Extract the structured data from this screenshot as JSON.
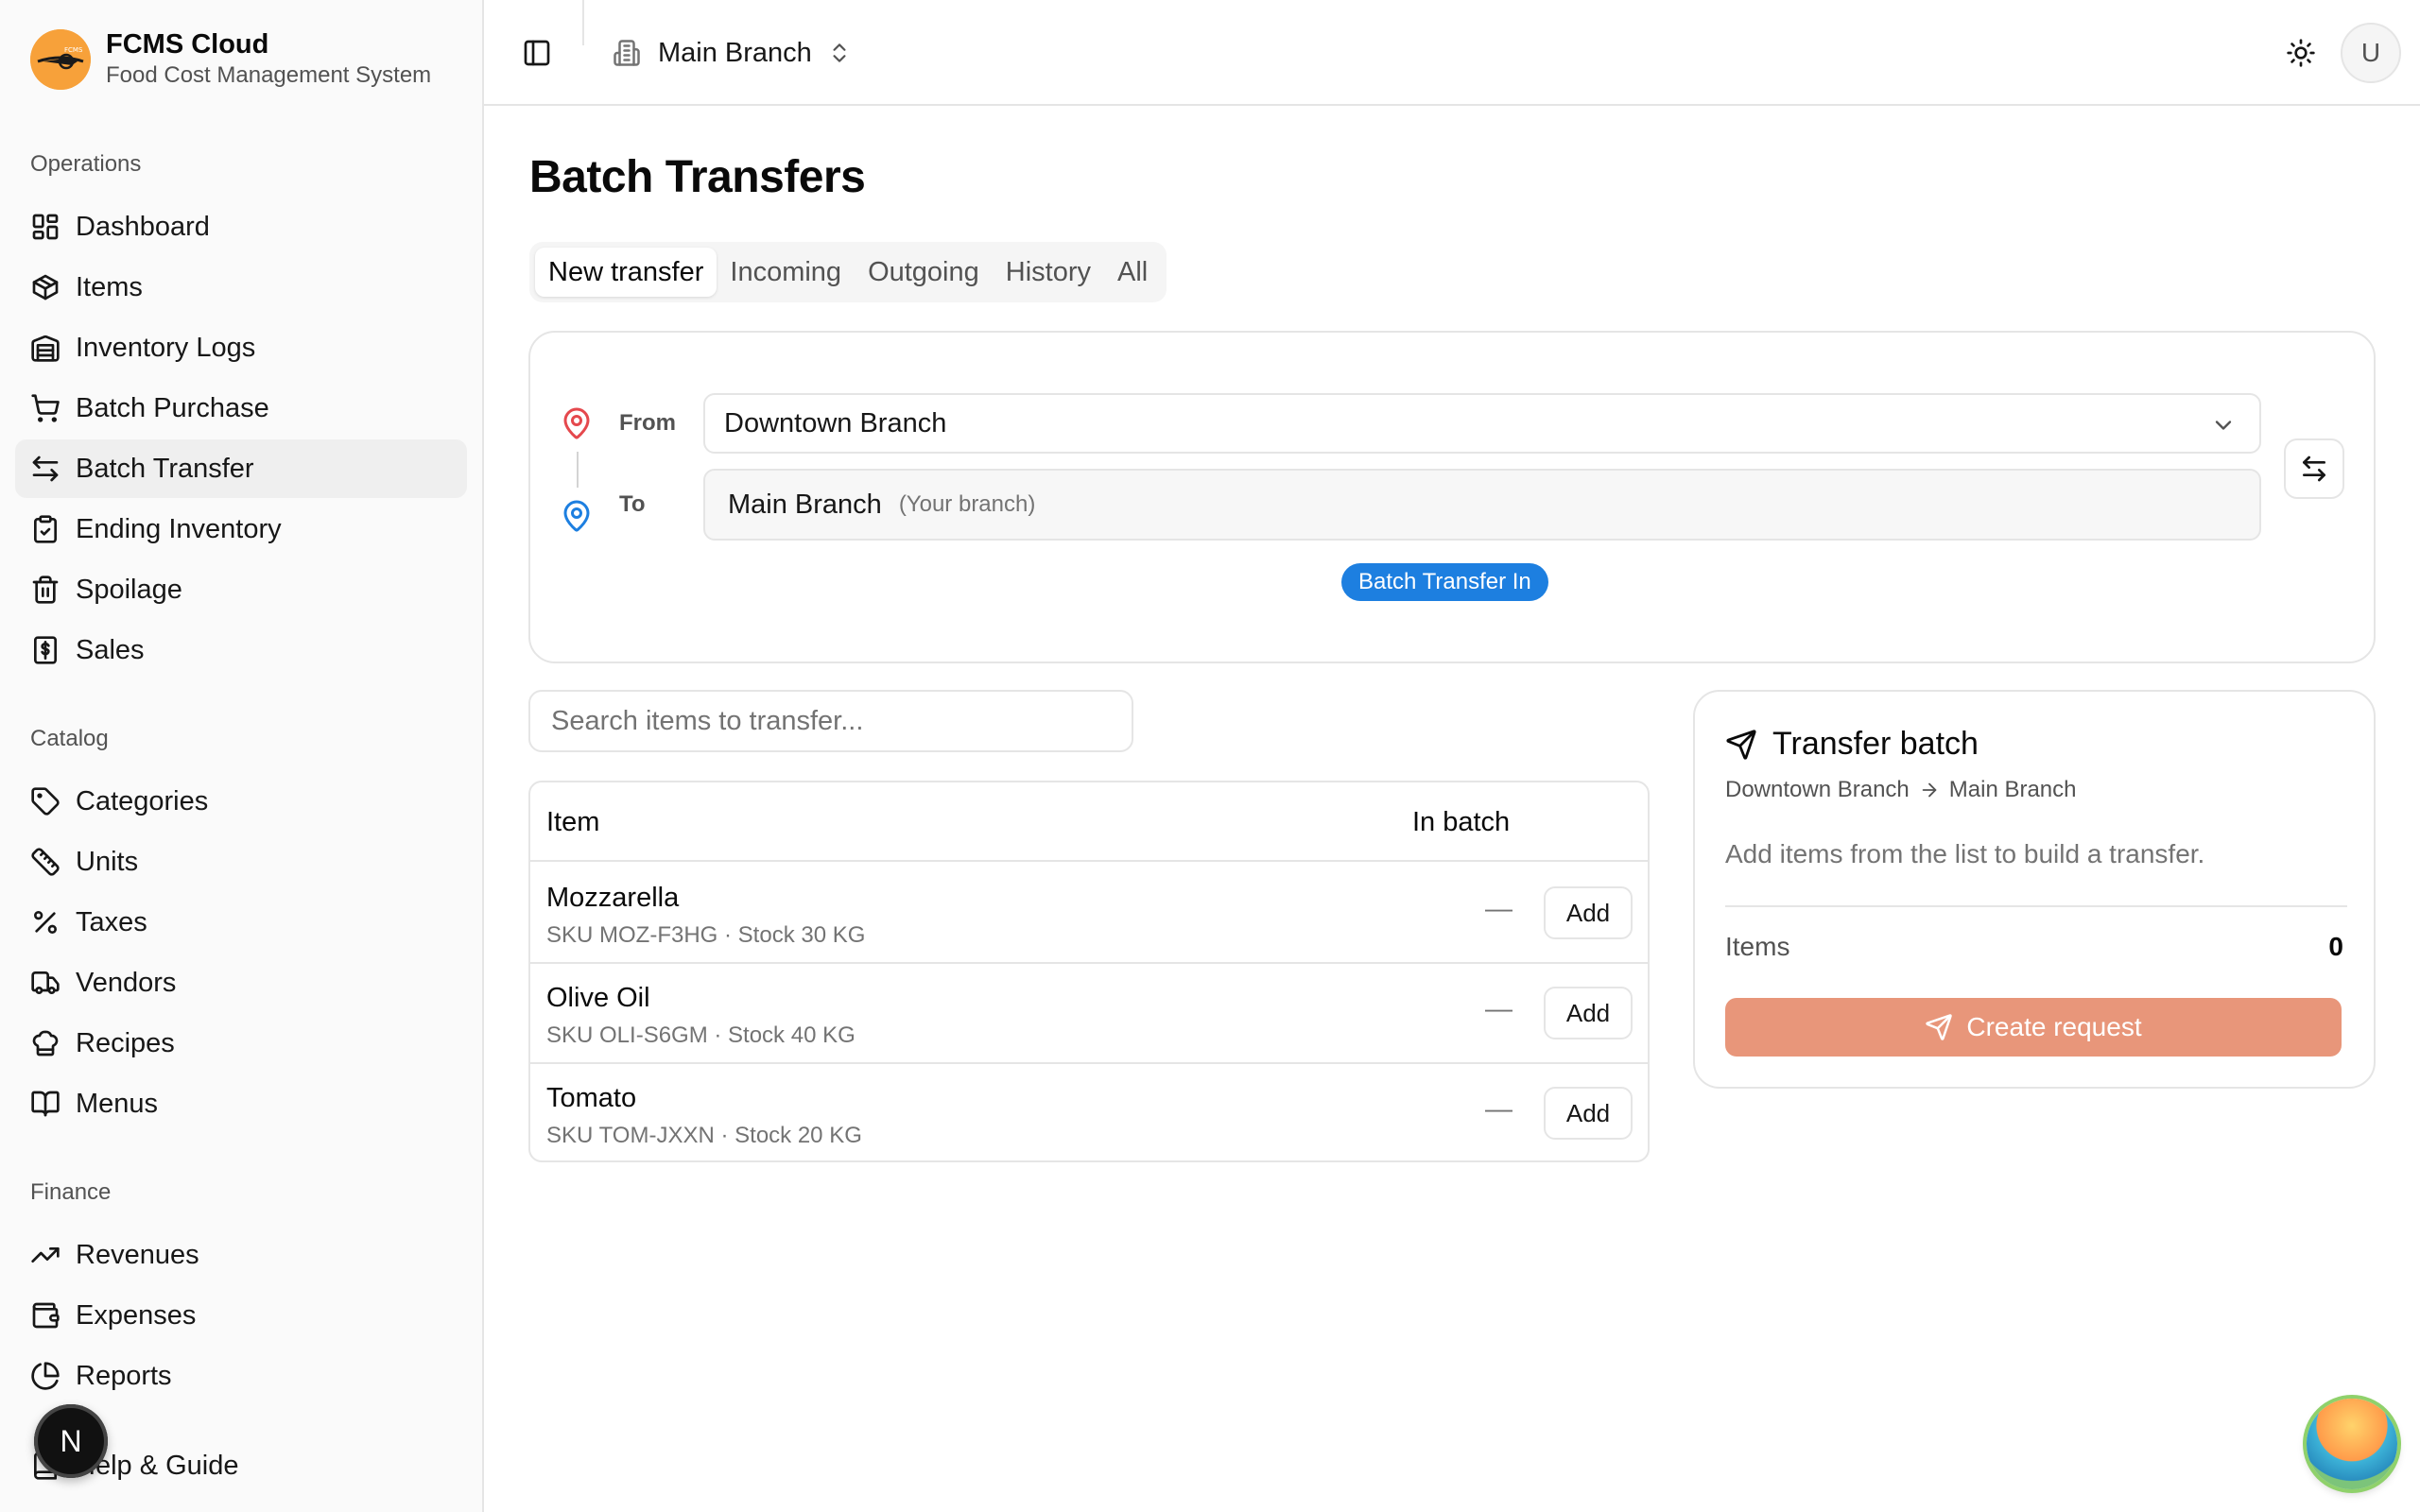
{
  "brand": {
    "name": "FCMS Cloud",
    "subtitle": "Food Cost Management System"
  },
  "sidebar": {
    "groups": [
      {
        "label": "Operations",
        "items": [
          {
            "label": "Dashboard",
            "icon": "dashboard-icon"
          },
          {
            "label": "Items",
            "icon": "box-icon"
          },
          {
            "label": "Inventory Logs",
            "icon": "warehouse-icon"
          },
          {
            "label": "Batch Purchase",
            "icon": "cart-icon"
          },
          {
            "label": "Batch Transfer",
            "icon": "transfer-icon",
            "active": true
          },
          {
            "label": "Ending Inventory",
            "icon": "clipboard-check-icon"
          },
          {
            "label": "Spoilage",
            "icon": "trash-icon"
          },
          {
            "label": "Sales",
            "icon": "receipt-dollar-icon"
          }
        ]
      },
      {
        "label": "Catalog",
        "items": [
          {
            "label": "Categories",
            "icon": "tag-icon"
          },
          {
            "label": "Units",
            "icon": "ruler-icon"
          },
          {
            "label": "Taxes",
            "icon": "percent-icon"
          },
          {
            "label": "Vendors",
            "icon": "truck-icon"
          },
          {
            "label": "Recipes",
            "icon": "chef-hat-icon"
          },
          {
            "label": "Menus",
            "icon": "book-open-icon"
          }
        ]
      },
      {
        "label": "Finance",
        "items": [
          {
            "label": "Revenues",
            "icon": "trending-up-icon"
          },
          {
            "label": "Expenses",
            "icon": "wallet-icon"
          },
          {
            "label": "Reports",
            "icon": "pie-chart-icon"
          },
          {
            "label": "Help & Guide",
            "icon": "book-icon"
          }
        ]
      }
    ],
    "dev_badge": "N"
  },
  "topbar": {
    "branch": "Main Branch",
    "avatar_initial": "U"
  },
  "page": {
    "title": "Batch Transfers",
    "tabs": [
      {
        "label": "New transfer",
        "active": true
      },
      {
        "label": "Incoming"
      },
      {
        "label": "Outgoing"
      },
      {
        "label": "History"
      },
      {
        "label": "All"
      }
    ]
  },
  "route": {
    "from_label": "From",
    "to_label": "To",
    "from_value": "Downtown Branch",
    "to_value": "Main Branch",
    "to_hint": "(Your branch)",
    "badge": "Batch Transfer In"
  },
  "search": {
    "placeholder": "Search items to transfer..."
  },
  "table": {
    "headers": {
      "item": "Item",
      "in_batch": "In batch"
    },
    "rows": [
      {
        "name": "Mozzarella",
        "meta": "SKU MOZ-F3HG · Stock 30 KG",
        "in_batch": "—",
        "action": "Add"
      },
      {
        "name": "Olive Oil",
        "meta": "SKU OLI-S6GM · Stock 40 KG",
        "in_batch": "—",
        "action": "Add"
      },
      {
        "name": "Tomato",
        "meta": "SKU TOM-JXXN · Stock 20 KG",
        "in_batch": "—",
        "action": "Add"
      }
    ]
  },
  "batch": {
    "title": "Transfer batch",
    "from": "Downtown Branch",
    "to": "Main Branch",
    "empty_text": "Add items from the list to build a transfer.",
    "items_label": "Items",
    "items_count": "0",
    "create_label": "Create request"
  },
  "colors": {
    "accent": "#e8967a",
    "primary_blue": "#1d7fe0",
    "pin_red": "#e5484d",
    "brand_orange": "#f7a13a"
  }
}
